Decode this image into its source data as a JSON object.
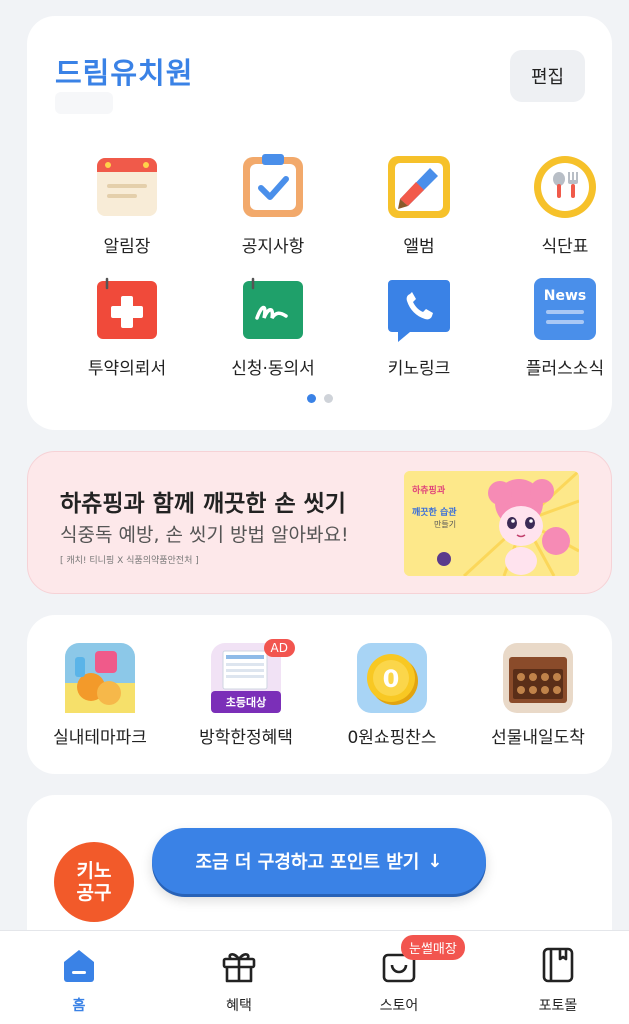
{
  "school": {
    "name": "드림유치원",
    "edit_label": "편집"
  },
  "menu": {
    "items": [
      {
        "label": "알림장",
        "icon": "notice-board-icon"
      },
      {
        "label": "공지사항",
        "icon": "announcement-clipboard-icon"
      },
      {
        "label": "앨범",
        "icon": "album-icon"
      },
      {
        "label": "식단표",
        "icon": "meal-plan-icon"
      },
      {
        "label": "투약의뢰서",
        "icon": "medication-request-icon"
      },
      {
        "label": "신청·동의서",
        "icon": "consent-form-icon"
      },
      {
        "label": "키노링크",
        "icon": "kinolink-phone-icon"
      },
      {
        "label": "플러스소식",
        "icon": "plus-news-icon"
      }
    ],
    "news_icon_text": "News",
    "page_count": 2,
    "active_page": 1
  },
  "banner": {
    "title": "하츄핑과 함께 깨끗한 손 씻기",
    "subtitle": "식중독 예방, 손 씻기 방법 알아봐요!",
    "note": "[ 캐치! 티니핑 X 식품의약품안전처 ]",
    "image_text_1": "하츄핑과",
    "image_text_2": "깨끗한 습관",
    "image_text_3": "만들기"
  },
  "shop": {
    "items": [
      {
        "label": "실내테마파크"
      },
      {
        "label": "방학한정혜택",
        "badge": "AD",
        "thumb_tag": "초등대상"
      },
      {
        "label": "0원쇼핑찬스",
        "thumb_text": "0"
      },
      {
        "label": "선물내일도착"
      }
    ]
  },
  "group": {
    "logo_line1": "키노",
    "logo_line2": "공구",
    "cta_label": "조금 더 구경하고 포인트 받기",
    "cta_arrow": "↓"
  },
  "nav": {
    "items": [
      {
        "label": "홈",
        "icon": "home-icon",
        "active": true
      },
      {
        "label": "혜택",
        "icon": "gift-icon"
      },
      {
        "label": "스토어",
        "icon": "store-icon",
        "badge": "눈썰매장"
      },
      {
        "label": "포토몰",
        "icon": "photo-mall-icon"
      }
    ]
  },
  "colors": {
    "accent": "#3a82e6",
    "badge": "#f2554f",
    "banner_bg": "#fde8ea",
    "background": "#f1f3f6"
  }
}
